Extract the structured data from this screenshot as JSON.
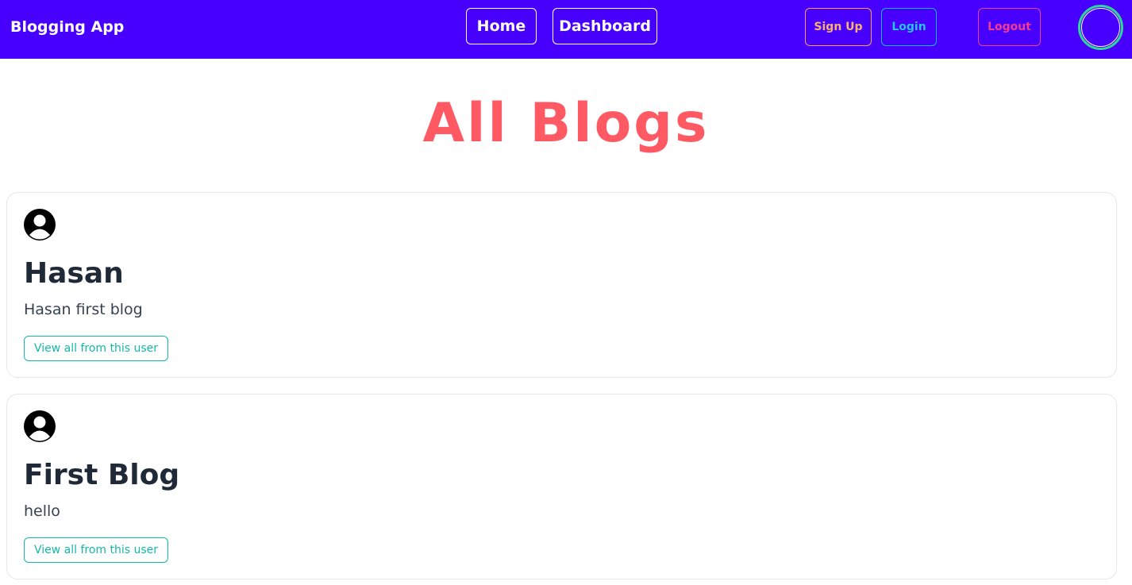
{
  "navbar": {
    "brand": "Blogging App",
    "home_label": "Home",
    "dashboard_label": "Dashboard",
    "signup_label": "Sign Up",
    "login_label": "Login",
    "logout_label": "Logout"
  },
  "page": {
    "title": "All Blogs"
  },
  "blogs": [
    {
      "title": "Hasan",
      "body": "Hasan first blog",
      "button_label": "View all from this user"
    },
    {
      "title": "First Blog",
      "body": "hello",
      "button_label": "View all from this user"
    }
  ],
  "colors": {
    "navbar_bg": "#4700fd",
    "title_color": "#ff5a63",
    "signup": "#f9a15b",
    "login": "#17b8d8",
    "logout": "#ec3f8e",
    "avatar_ring": "#2ed795",
    "view_button": "#14b8a6"
  },
  "icons": {
    "user": "user-avatar-icon",
    "profile": "profile-avatar-icon"
  }
}
